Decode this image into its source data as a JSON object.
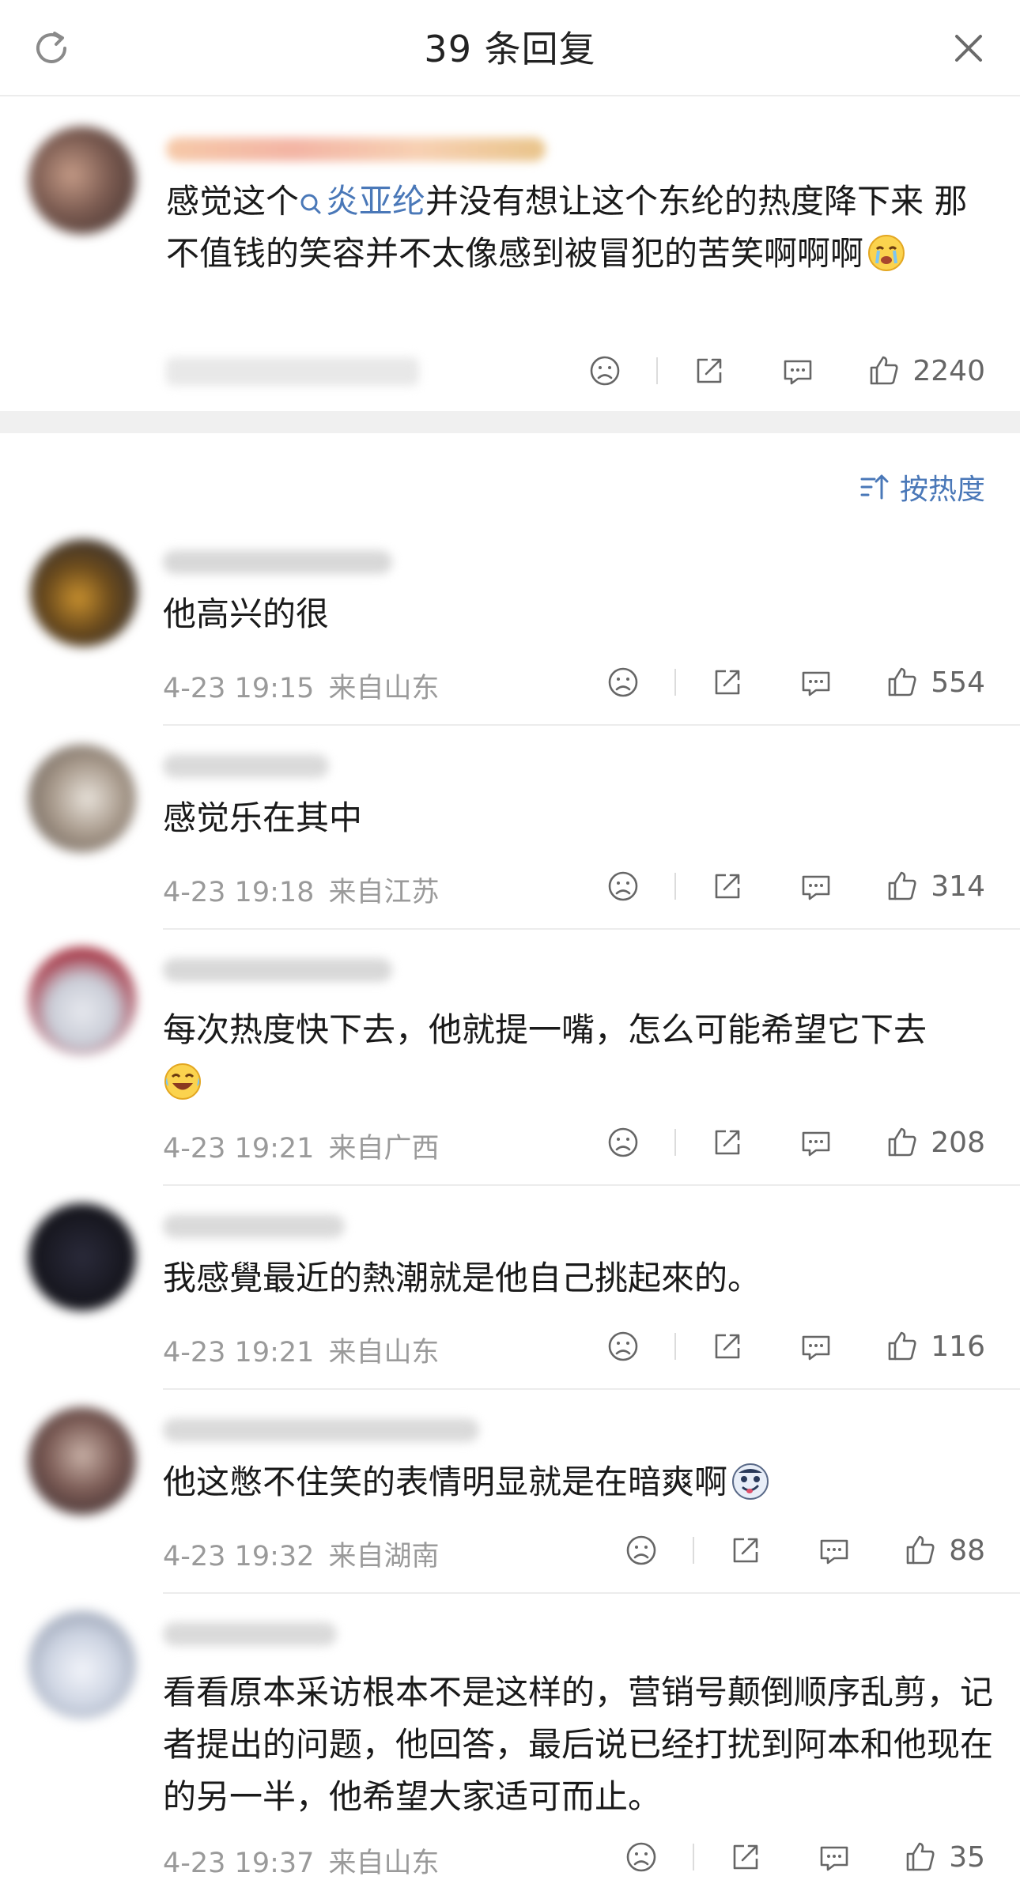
{
  "header": {
    "title": "39 条回复",
    "refresh_icon": "refresh-icon",
    "close_icon": "close-icon"
  },
  "main_comment": {
    "text_before": "感觉这个",
    "topic": "炎亚纶",
    "text_after": "并没有想让这个东纶的热度降下来 那不值钱的笑容并不太像感到被冒犯的苦笑啊啊啊",
    "emoji": "crying-emoji",
    "like_count": "2240"
  },
  "sort": {
    "label": "按热度"
  },
  "replies": [
    {
      "text": "他高兴的很",
      "date": "4-23 19:15",
      "location": "来自山东",
      "likes": "554"
    },
    {
      "text": "感觉乐在其中",
      "date": "4-23 19:18",
      "location": "来自江苏",
      "likes": "314"
    },
    {
      "text": "每次热度快下去，他就提一嘴，怎么可能希望它下去",
      "emoji": "laughing-tears-emoji",
      "date": "4-23 19:21",
      "location": "来自广西",
      "likes": "208"
    },
    {
      "text": "我感覺最近的熱潮就是他自己挑起來的。",
      "date": "4-23 19:21",
      "location": "来自山东",
      "likes": "116"
    },
    {
      "text": "他这憋不住笑的表情明显就是在暗爽啊",
      "emoji": "smirk-emoji",
      "date": "4-23 19:32",
      "location": "来自湖南",
      "likes": "88"
    },
    {
      "text": "看看原本采访根本不是这样的，营销号颠倒顺序乱剪，记者提出的问题，他回答，最后说已经打扰到阿本和他现在的另一半，他希望大家适可而止。",
      "date": "4-23 19:37",
      "location": "来自山东",
      "likes": "35"
    }
  ],
  "colors": {
    "link": "#4a78b8",
    "meta_text": "#9a9a9a",
    "divider": "#ececec",
    "section_gap": "#f0f0f0"
  }
}
